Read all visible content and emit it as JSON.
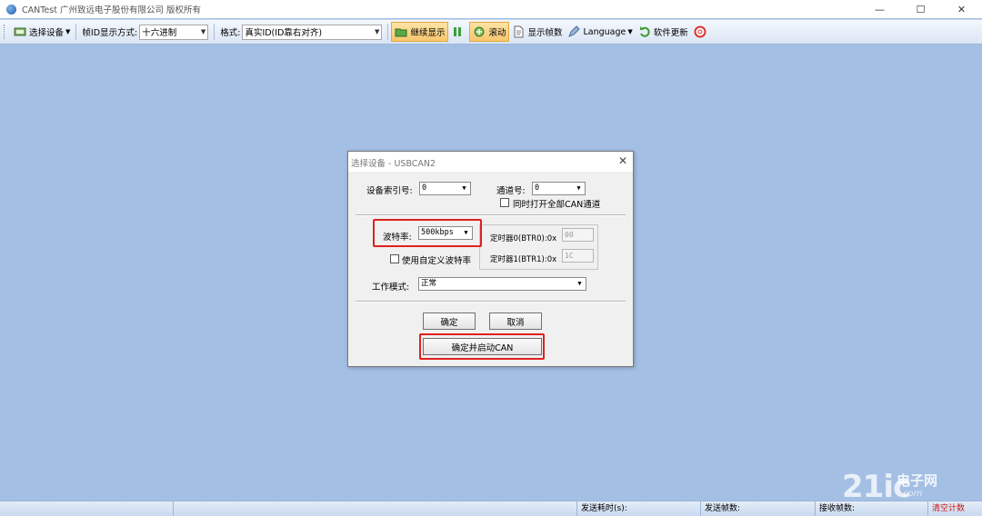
{
  "window": {
    "title": "CANTest   广州致远电子股份有限公司 版权所有",
    "minimize": "—",
    "maximize": "☐",
    "close": "✕"
  },
  "toolbar": {
    "select_device": "选择设备",
    "frame_id_format_label": "帧ID显示方式:",
    "frame_id_format_value": "十六进制",
    "format_label": "格式:",
    "format_value": "真实ID(ID靠右对齐)",
    "continue_display": "继续显示",
    "scroll": "滚动",
    "display_frames": "显示帧数",
    "language": "Language",
    "software_update": "软件更新"
  },
  "statusbar": {
    "send_time": "发送耗时(s):",
    "send_frames": "发送帧数:",
    "recv_frames": "接收帧数:",
    "clear_count": "清空计数"
  },
  "watermark": {
    "brand": "21ic",
    "chinese": "电子网",
    "url": ".com"
  },
  "dialog": {
    "title": "选择设备 - USBCAN2",
    "close": "✕",
    "device_index_label": "设备索引号:",
    "device_index_value": "0",
    "channel_label": "通道号:",
    "channel_value": "0",
    "open_all_channels": "同时打开全部CAN通道",
    "baud_label": "波特率:",
    "baud_value": "500kbps",
    "timer0_label": "定时器0(BTR0):0x",
    "timer0_value": "00",
    "timer1_label": "定时器1(BTR1):0x",
    "timer1_value": "1C",
    "custom_baud": "使用自定义波特率",
    "work_mode_label": "工作模式:",
    "work_mode_value": "正常",
    "ok": "确定",
    "cancel": "取消",
    "ok_and_start": "确定并启动CAN"
  },
  "colors": {
    "client_bg": "#a4bfe4",
    "highlight_box": "#e02020",
    "active_button": "#f8c76d"
  }
}
